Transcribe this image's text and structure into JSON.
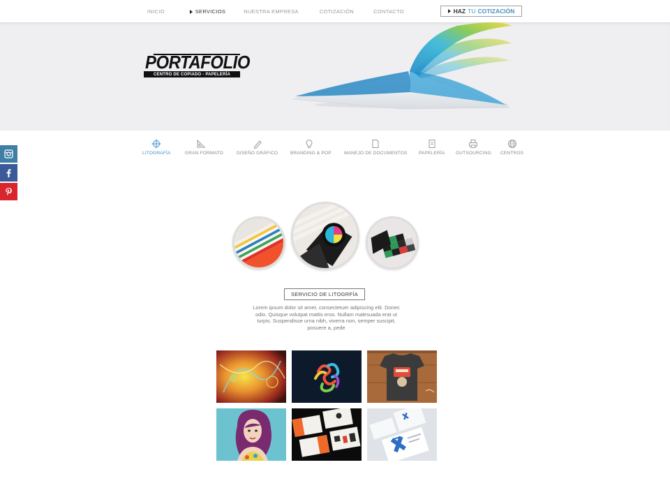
{
  "nav": {
    "items": [
      {
        "label": "INICIO",
        "active": false
      },
      {
        "label": "SERVICIOS",
        "active": true
      },
      {
        "label": "NUESTRA EMPRESA",
        "active": false
      },
      {
        "label": "COTIZACIÓN",
        "active": false
      },
      {
        "label": "CONTACTO",
        "active": false
      }
    ],
    "quote_button": {
      "part1": "HAZ",
      "part2": "TU",
      "part3": "COTIZACIÓN"
    }
  },
  "hero": {
    "logo_word": "PORTAFOLIO",
    "logo_tagline": "CENTRO DE COPIADO - PAPELERÍA"
  },
  "services": [
    {
      "label": "LITOGRAFÍA",
      "icon": "crosshair-icon",
      "active": true
    },
    {
      "label": "GRAN FORMATO",
      "icon": "triangle-ruler-icon",
      "active": false
    },
    {
      "label": "DISEÑO GRÁFICO",
      "icon": "pen-icon",
      "active": false
    },
    {
      "label": "BRANDING & POP",
      "icon": "lightbulb-icon",
      "active": false
    },
    {
      "label": "MANEJO DE DOCUMENTOS",
      "icon": "document-icon",
      "active": false
    },
    {
      "label": "PAPELERÍA",
      "icon": "notepad-icon",
      "active": false
    },
    {
      "label": "OUTSOURCING",
      "icon": "printer-icon",
      "active": false
    },
    {
      "label": "CENTROS",
      "icon": "globe-icon",
      "active": false
    }
  ],
  "social": [
    "instagram-icon",
    "facebook-icon",
    "pinterest-icon"
  ],
  "section": {
    "title": "SERVICIO DE LITOGRFÍA",
    "text": "Lorem ipsum dolor sit amet, consectetuer adipiscing elit. Donec odio. Quisque volutpat mattis eros. Nullam malesuada erat ut turpis. Suspendisse urna nibh, viverra non, semper suscipit, posuere a, pede"
  },
  "colors": {
    "accent": "#3a8fd0",
    "instagram": "#3f7fa6",
    "facebook": "#3b5a9a",
    "pinterest": "#d8262c"
  }
}
